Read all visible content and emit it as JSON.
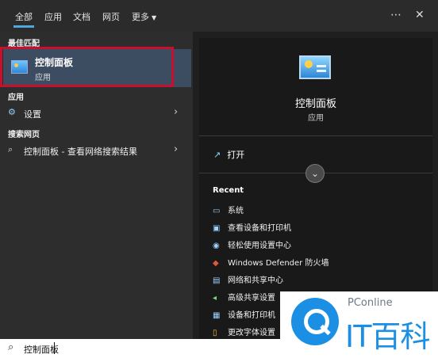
{
  "tabs": [
    "全部",
    "应用",
    "文档",
    "网页",
    "更多"
  ],
  "best_match": {
    "section": "最佳匹配",
    "title": "控制面板",
    "subtitle": "应用"
  },
  "apps": {
    "section": "应用",
    "item": "设置"
  },
  "web": {
    "section": "搜索网页",
    "item": "控制面板 - 查看网络搜索结果"
  },
  "detail": {
    "title": "控制面板",
    "subtitle": "应用",
    "open": "打开",
    "recent_label": "Recent",
    "recent": [
      {
        "label": "系统",
        "icon": "monitor-icon"
      },
      {
        "label": "查看设备和打印机",
        "icon": "devices-icon"
      },
      {
        "label": "轻松使用设置中心",
        "icon": "accessibility-icon"
      },
      {
        "label": "Windows Defender 防火墙",
        "icon": "firewall-icon"
      },
      {
        "label": "网络和共享中心",
        "icon": "network-icon"
      },
      {
        "label": "高级共享设置",
        "icon": "share-icon"
      },
      {
        "label": "设备和打印机",
        "icon": "printer-icon"
      },
      {
        "label": "更改字体设置",
        "icon": "font-icon"
      }
    ]
  },
  "search": {
    "value": "控制面板"
  },
  "watermark": {
    "small": "PConline",
    "big": "IT百科"
  },
  "colors": {
    "accent": "#4ea8de",
    "highlight_border": "#c8102e",
    "selected_bg": "#3c4d62",
    "brand_blue": "#1a8fe3"
  }
}
